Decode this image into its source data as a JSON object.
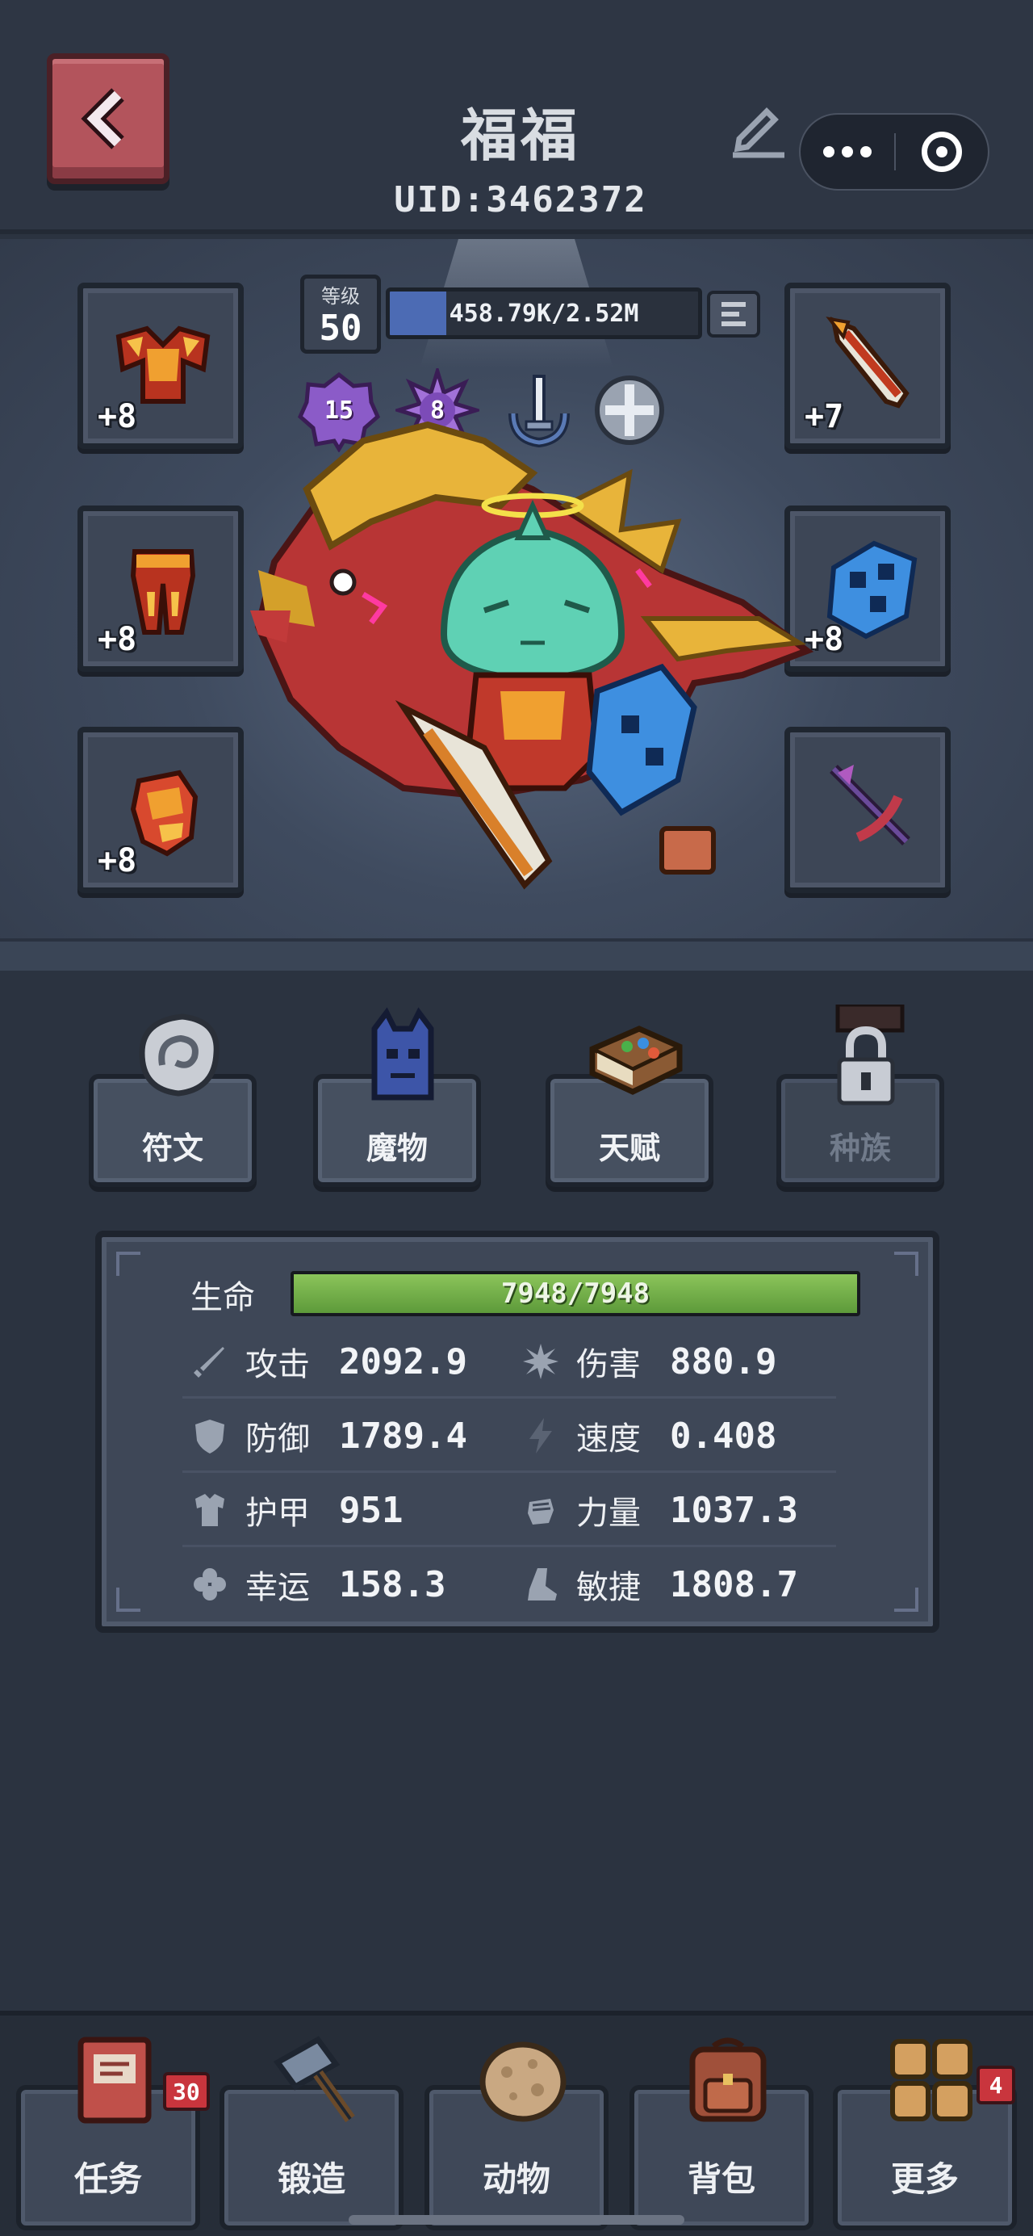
{
  "header": {
    "player_name": "福福",
    "uid": "UID:3462372"
  },
  "level": {
    "label": "等级",
    "value": "50",
    "xp_text": "458.79K/2.52M",
    "xp_fraction": 0.182
  },
  "badges": [
    {
      "value": "15",
      "icon": "purple-rank-badge-icon"
    },
    {
      "value": "8",
      "icon": "star-rank-badge-icon"
    },
    {
      "value": "",
      "icon": "sword-emblem-icon"
    },
    {
      "value": "",
      "icon": "shield-emblem-icon"
    }
  ],
  "equipment": {
    "left": [
      {
        "enhance": "+8",
        "icon": "armor-chest-icon"
      },
      {
        "enhance": "+8",
        "icon": "armor-pants-icon"
      },
      {
        "enhance": "+8",
        "icon": "armor-gauntlet-icon"
      }
    ],
    "right": [
      {
        "enhance": "+7",
        "icon": "sword-weapon-icon"
      },
      {
        "enhance": "+8",
        "icon": "blue-shield-icon"
      },
      {
        "enhance": "",
        "icon": "dark-crossbow-icon"
      }
    ]
  },
  "tabs": [
    {
      "label": "符文",
      "icon": "rune-stone-icon",
      "locked": false
    },
    {
      "label": "魔物",
      "icon": "monster-icon",
      "locked": false
    },
    {
      "label": "天赋",
      "icon": "talent-book-icon",
      "locked": false
    },
    {
      "label": "种族",
      "icon": "lock-icon",
      "locked": true
    }
  ],
  "stats": {
    "hp_label": "生命",
    "hp_text": "7948/7948",
    "hp_fraction": 1.0,
    "rows": [
      [
        {
          "name": "攻击",
          "value": "2092.9",
          "icon": "sword-icon"
        },
        {
          "name": "伤害",
          "value": "880.9",
          "icon": "burst-icon"
        }
      ],
      [
        {
          "name": "防御",
          "value": "1789.4",
          "icon": "shield-icon"
        },
        {
          "name": "速度",
          "value": "0.408",
          "icon": "lightning-icon"
        }
      ],
      [
        {
          "name": "护甲",
          "value": "951",
          "icon": "armor-icon"
        },
        {
          "name": "力量",
          "value": "1037.3",
          "icon": "fist-icon"
        }
      ],
      [
        {
          "name": "幸运",
          "value": "158.3",
          "icon": "clover-icon"
        },
        {
          "name": "敏捷",
          "value": "1808.7",
          "icon": "boot-icon"
        }
      ]
    ]
  },
  "bottom_nav": [
    {
      "label": "任务",
      "icon": "quest-book-icon",
      "badge": "30"
    },
    {
      "label": "锻造",
      "icon": "hammer-icon",
      "badge": ""
    },
    {
      "label": "动物",
      "icon": "egg-icon",
      "badge": ""
    },
    {
      "label": "背包",
      "icon": "backpack-icon",
      "badge": ""
    },
    {
      "label": "更多",
      "icon": "grid-more-icon",
      "badge": "4"
    }
  ],
  "colors": {
    "background": "#2b3340",
    "back_button": "#b3545c",
    "xp_fill": "#4c6bb4",
    "hp_fill": "#6fae45",
    "badge_red": "#c9353d"
  }
}
